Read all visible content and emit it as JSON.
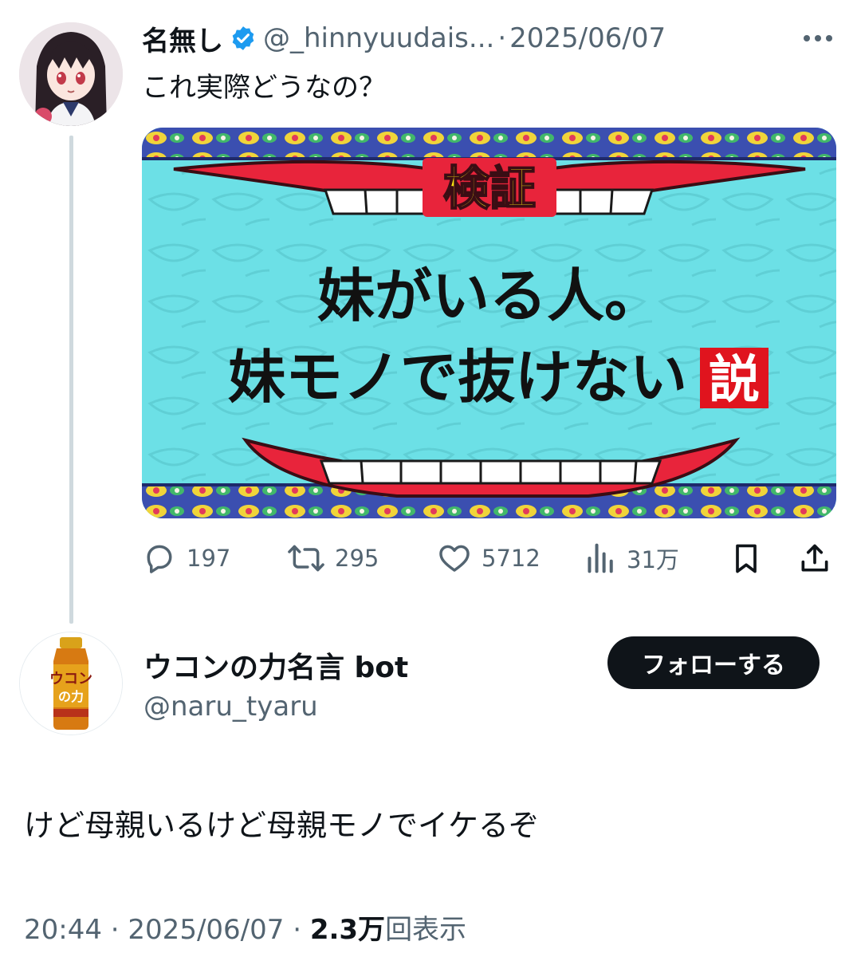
{
  "tweet": {
    "author_name": "名無し",
    "author_handle": "@_hinnyuudais...",
    "separator": "·",
    "date": "2025/06/07",
    "text": "これ実際どうなの？",
    "media": {
      "badge": "検証",
      "line1": "妹がいる人。",
      "line2": "妹モノで抜けない",
      "stamp": "説"
    },
    "actions": {
      "replies": "197",
      "reposts": "295",
      "likes": "5712",
      "views": "31万"
    },
    "icons": [
      "verified-badge-icon",
      "more-icon",
      "reply-icon",
      "repost-icon",
      "like-icon",
      "views-icon",
      "bookmark-icon",
      "share-icon"
    ]
  },
  "reply_user": {
    "name": "ウコンの力名言 bot",
    "handle": "@naru_tyaru",
    "follow_label": "フォローする",
    "text": "けど母親いるけど母親モノでイケるぞ"
  },
  "meta": {
    "time": "20:44",
    "sep1": " · ",
    "date": "2025/06/07",
    "sep2": " · ",
    "views_count": "2.3万",
    "views_label": "回表示"
  },
  "colors": {
    "text": "#0f1419",
    "muted": "#536471",
    "verified": "#1d9bf0",
    "media_bg": "#6ce0e6",
    "lips": "#e8243b",
    "badge_yellow": "#f7e413",
    "stamp_red": "#e0141e"
  }
}
